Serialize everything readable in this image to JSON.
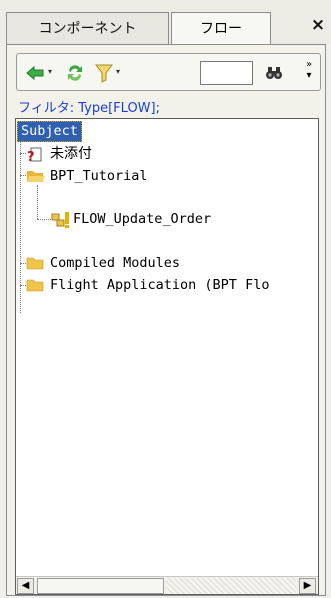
{
  "tabs": [
    {
      "label": "コンポーネント",
      "active": false
    },
    {
      "label": "フロー",
      "active": true
    }
  ],
  "window": {
    "close_label": "×"
  },
  "toolbar": {
    "back_icon": "arrow-left-icon",
    "refresh_icon": "sync-arrows-icon",
    "filter_icon": "funnel-icon",
    "search_icon": "binoculars-icon",
    "dropdown_glyph": "▾",
    "search_value": "",
    "more_label": "»"
  },
  "filter_text": "フィルタ: Type[FLOW];",
  "tree": {
    "items": [
      {
        "label": "Subject",
        "icon": "none",
        "selected": true
      },
      {
        "label": "未添付",
        "icon": "question-document-icon"
      },
      {
        "label": "BPT_Tutorial",
        "icon": "open-folder-icon"
      },
      {
        "label": "FLOW_Update_Order",
        "icon": "flow-warning-icon"
      },
      {
        "label": "Compiled Modules",
        "icon": "folder-icon"
      },
      {
        "label": "Flight Application (BPT Flo",
        "icon": "folder-icon"
      }
    ]
  },
  "colors": {
    "selection": "#2f60b0",
    "folder": "#f0c34b",
    "filter_text": "#1a3fd0"
  }
}
